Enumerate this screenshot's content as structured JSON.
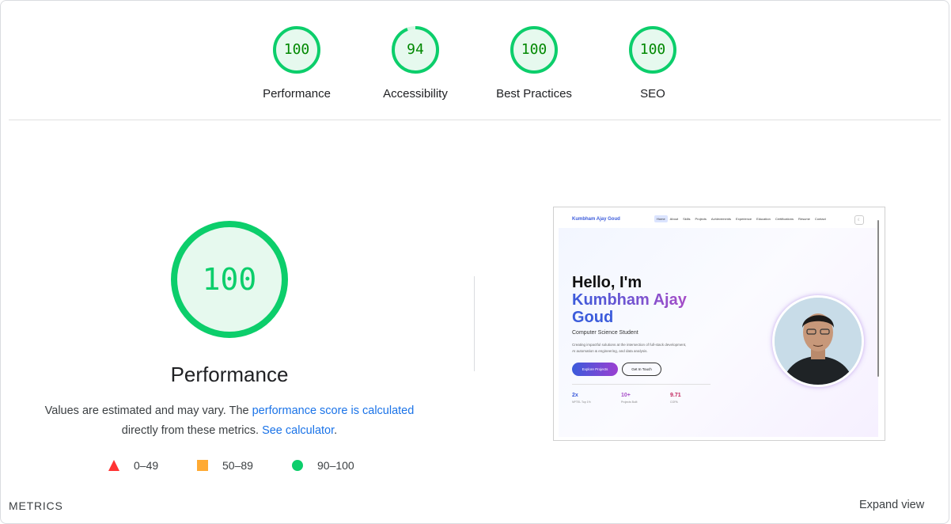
{
  "categories": [
    {
      "label": "Performance",
      "score": "100",
      "value": 100
    },
    {
      "label": "Accessibility",
      "score": "94",
      "value": 94
    },
    {
      "label": "Best Practices",
      "score": "100",
      "value": 100
    },
    {
      "label": "SEO",
      "score": "100",
      "value": 100
    }
  ],
  "performance": {
    "score": "100",
    "title": "Performance",
    "desc_prefix": "Values are estimated and may vary. The ",
    "desc_link": "performance score is calculated",
    "desc_mid": " directly from these metrics. ",
    "desc_link2": "See calculator",
    "desc_suffix": "."
  },
  "legend": [
    {
      "shape": "triangle",
      "label": "0–49",
      "color": "#ff3333"
    },
    {
      "shape": "square",
      "label": "50–89",
      "color": "#ffaa33"
    },
    {
      "shape": "circle",
      "label": "90–100",
      "color": "#0cce6b"
    }
  ],
  "screenshot": {
    "brand": "Kumbham Ajay Goud",
    "nav": [
      "Home",
      "About",
      "Skills",
      "Projects",
      "Achievements",
      "Experience",
      "Education",
      "Certifications",
      "Resume",
      "Contact"
    ],
    "theme_icon": "moon-icon",
    "hello": "Hello, I'm",
    "name_line1": "Kumbham Ajay",
    "name_line2": "Goud",
    "subtitle": "Computer Science Student",
    "blurb_line1": "Creating impactful solutions at the intersection of full-stack development,",
    "blurb_line2": "AI automation & engineering, and data analysis.",
    "btn_primary": "Explore Projects",
    "btn_secondary": "Get In Touch",
    "stats": [
      {
        "value": "2x",
        "label": "NPTEL Top 1%",
        "color": "#3b5bdb"
      },
      {
        "value": "10+",
        "label": "Projects Built",
        "color": "#a64cc7"
      },
      {
        "value": "9.71",
        "label": "CGPA",
        "color": "#c2255c"
      }
    ]
  },
  "metrics_label": "METRICS",
  "expand_label": "Expand view",
  "colors": {
    "pass": "#0cce6b",
    "pass_text": "#008800",
    "link": "#1a73e8"
  }
}
